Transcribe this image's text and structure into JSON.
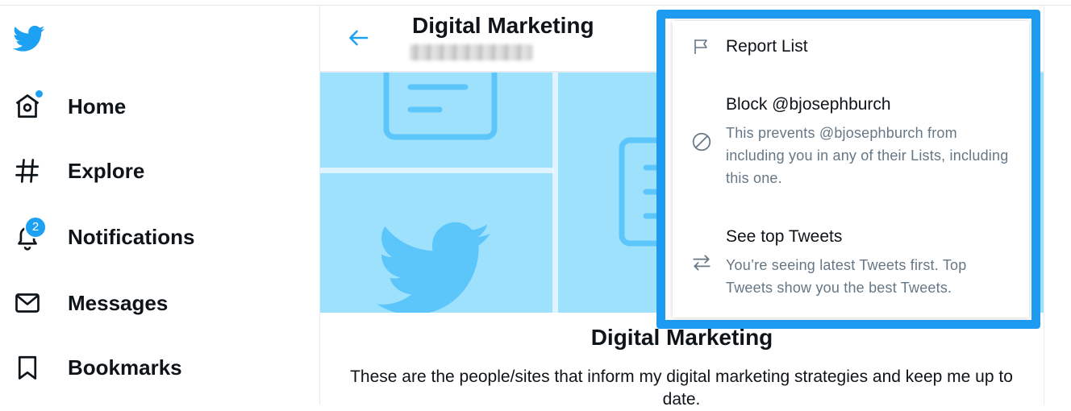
{
  "sidebar": {
    "logo_icon": "twitter-bird-icon",
    "items": [
      {
        "label": "Home",
        "icon": "home-icon"
      },
      {
        "label": "Explore",
        "icon": "hashtag-icon"
      },
      {
        "label": "Notifications",
        "icon": "bell-icon",
        "badge": "2"
      },
      {
        "label": "Messages",
        "icon": "envelope-icon"
      },
      {
        "label": "Bookmarks",
        "icon": "bookmark-icon"
      }
    ]
  },
  "header": {
    "title": "Digital Marketing",
    "back_icon": "arrow-left-icon"
  },
  "list": {
    "name": "Digital Marketing",
    "description": "These are the people/sites that inform my digital marketing strategies and keep me up to date."
  },
  "menu": {
    "report": {
      "title": "Report List",
      "icon": "flag-icon"
    },
    "block": {
      "title": "Block @bjosephburch",
      "subtitle": "This prevents @bjosephburch from including you in any of their Lists, including this one.",
      "icon": "block-icon"
    },
    "top_tweets": {
      "title": "See top Tweets",
      "subtitle": "You’re seeing latest Tweets first. Top Tweets show you the best Tweets.",
      "icon": "swap-arrows-icon"
    }
  },
  "colors": {
    "brand": "#1da1f2",
    "highlight": "#1d9bf0",
    "banner_bg": "#9ee1fd",
    "banner_art": "#5cc6fb",
    "secondary_text": "#657786"
  }
}
